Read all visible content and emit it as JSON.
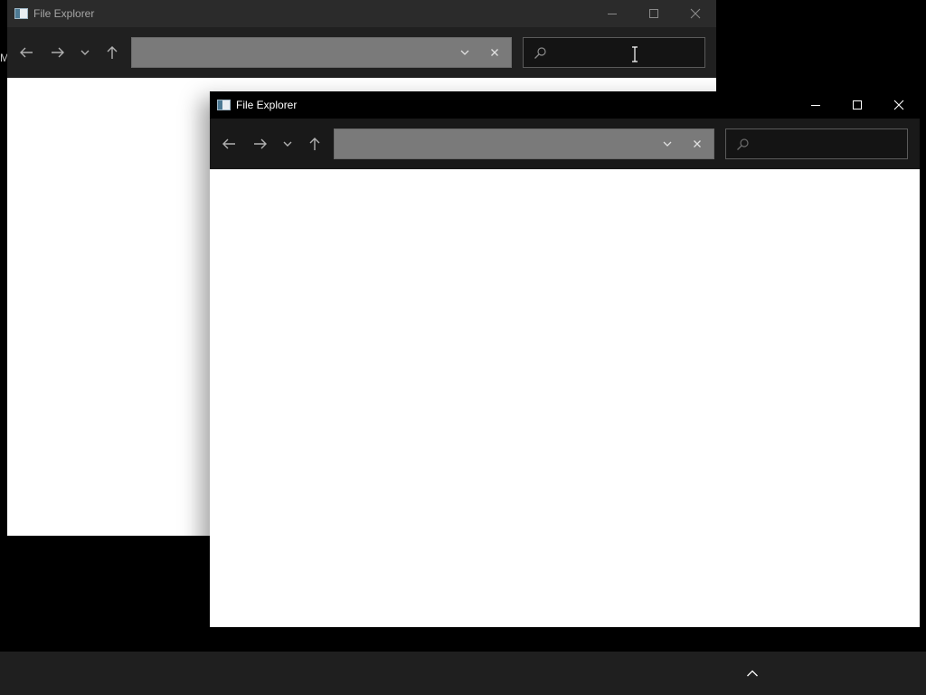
{
  "desktop": {
    "stray_text": "M"
  },
  "back_window": {
    "title": "File Explorer",
    "address_value": "",
    "search_value": ""
  },
  "front_window": {
    "title": "File Explorer",
    "address_value": "",
    "search_value": ""
  },
  "icons": {
    "app": "file-explorer-icon",
    "back": "arrow-left-icon",
    "forward": "arrow-right-icon",
    "recent": "chevron-down-icon",
    "up": "arrow-up-icon",
    "address_dropdown": "chevron-down-icon",
    "address_clear": "close-icon",
    "search": "search-icon",
    "minimize": "minimize-icon",
    "maximize": "maximize-icon",
    "close": "close-icon",
    "tray": "chevron-up-icon"
  },
  "colors": {
    "desktop": "#000000",
    "taskbar": "#1f1f1f",
    "address_bar": "#7a7a7a",
    "content": "#ffffff"
  }
}
